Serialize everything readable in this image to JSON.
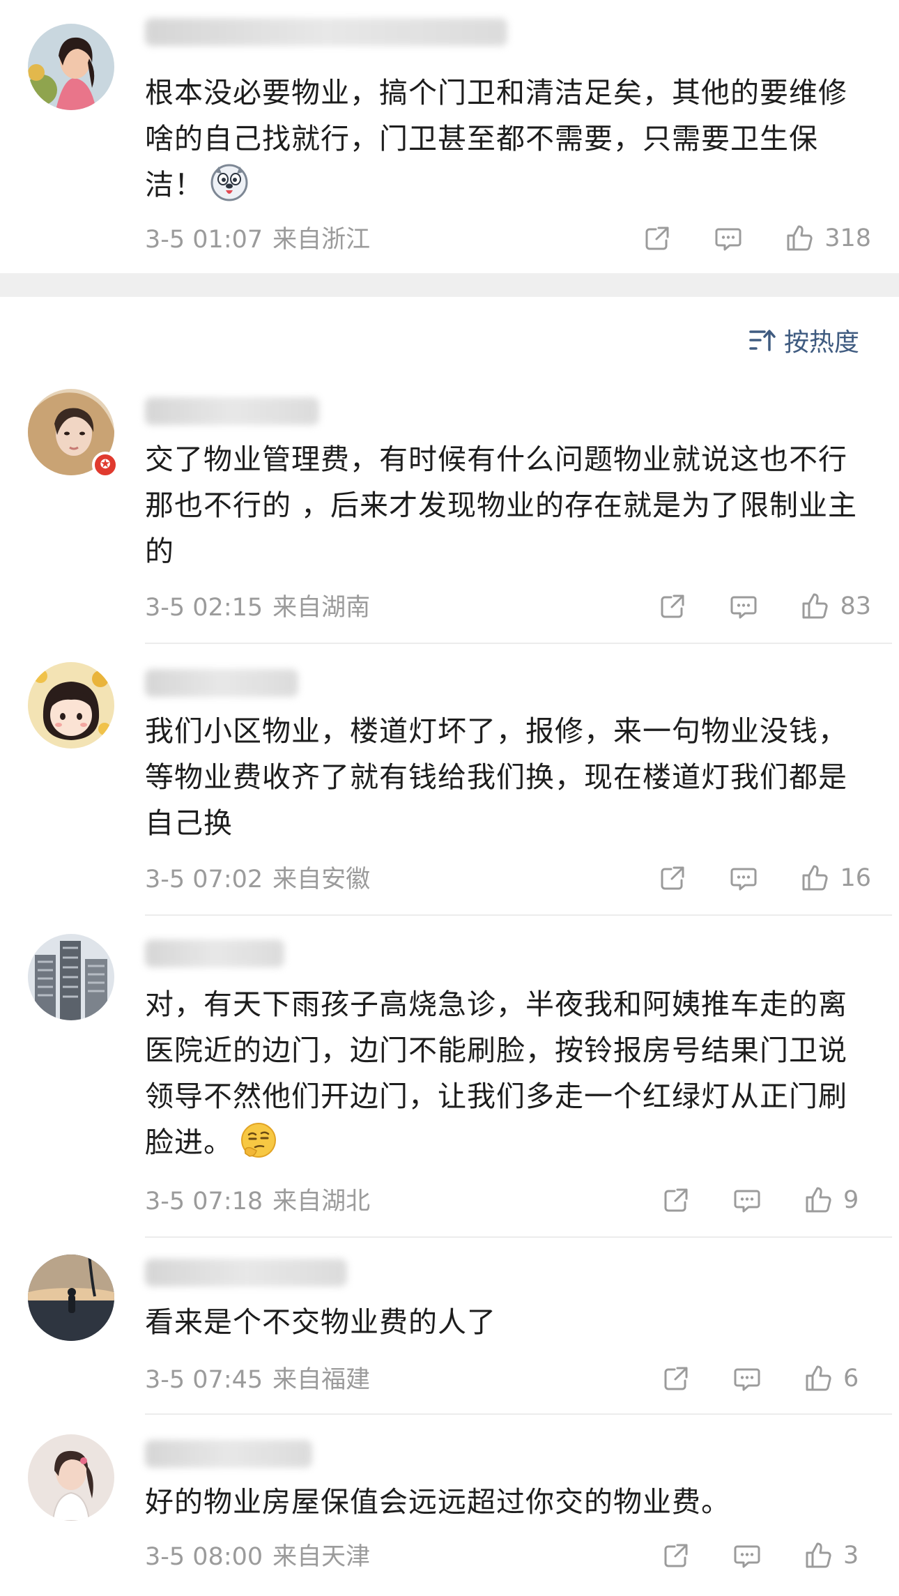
{
  "top_comment": {
    "text": "根本没必要物业，搞个门卫和清洁足矣，其他的要维修啥的自己找就行，门卫甚至都不需要，只需要卫生保洁！",
    "emoji": "doge-face-emoji",
    "date": "3-5 01:07",
    "location": "来自浙江",
    "likes": "318"
  },
  "sort": {
    "label": "按热度",
    "icon": "sort-icon"
  },
  "comments": [
    {
      "text": "交了物业管理费，有时候有什么问题物业就说这也不行那也不行的 ，后来才发现物业的存在就是为了限制业主的",
      "date": "3-5 02:15",
      "location": "来自湖南",
      "likes": "83",
      "verified_badge": true
    },
    {
      "text": "我们小区物业，楼道灯坏了，报修，来一句物业没钱，等物业费收齐了就有钱给我们换，现在楼道灯我们都是自己换",
      "date": "3-5 07:02",
      "location": "来自安徽",
      "likes": "16"
    },
    {
      "text": "对，有天下雨孩子高烧急诊，半夜我和阿姨推车走的离医院近的边门，边门不能刷脸，按铃报房号结果门卫说领导不然他们开边门，让我们多走一个红绿灯从正门刷脸进。",
      "emoji": "thinking-face-emoji",
      "date": "3-5 07:18",
      "location": "来自湖北",
      "likes": "9"
    },
    {
      "text": "看来是个不交物业费的人了",
      "date": "3-5 07:45",
      "location": "来自福建",
      "likes": "6"
    },
    {
      "text": "好的物业房屋保值会远远超过你交的物业费。",
      "date": "3-5 08:00",
      "location": "来自天津",
      "likes": "3"
    }
  ],
  "icons": {
    "share": "share-icon",
    "reply": "comment-icon",
    "like": "thumbs-up-icon"
  },
  "colors": {
    "text": "#1d1d1d",
    "meta": "#9b9b9b",
    "sort_accent": "#3f5b80",
    "badge": "#e03a2e"
  }
}
